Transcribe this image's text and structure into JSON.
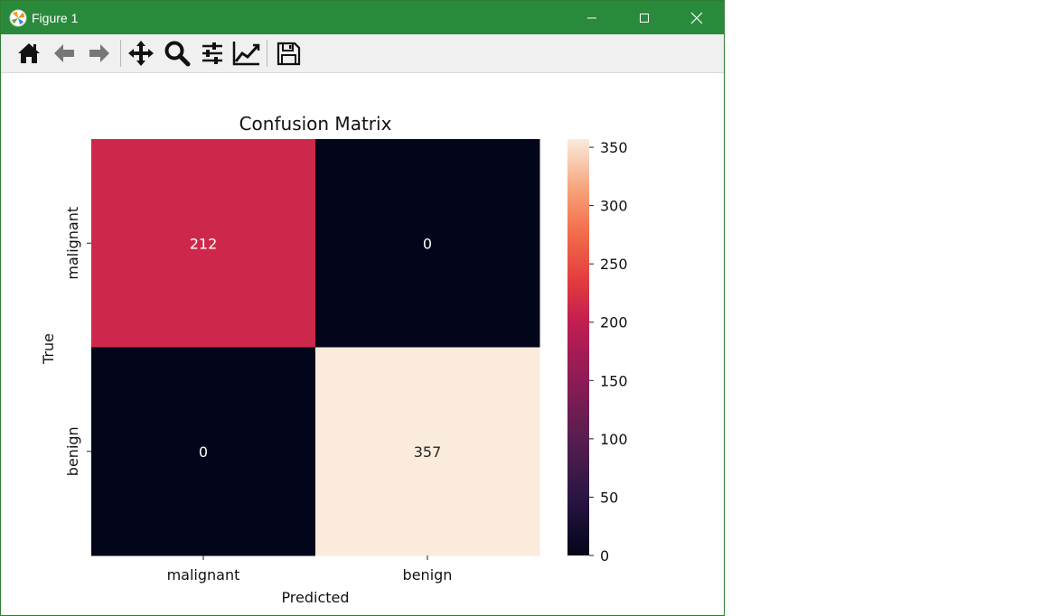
{
  "window": {
    "title": "Figure 1"
  },
  "toolbar": {
    "buttons": [
      {
        "name": "home-button",
        "icon": "home-icon"
      },
      {
        "name": "back-button",
        "icon": "arrow-left-icon"
      },
      {
        "name": "forward-button",
        "icon": "arrow-right-icon"
      },
      {
        "name": "pan-button",
        "icon": "move-icon"
      },
      {
        "name": "zoom-button",
        "icon": "magnifier-icon"
      },
      {
        "name": "configure-subplots-button",
        "icon": "sliders-icon"
      },
      {
        "name": "edit-axis-button",
        "icon": "line-chart-icon"
      },
      {
        "name": "save-button",
        "icon": "floppy-disk-icon"
      }
    ]
  },
  "colors": {
    "titlebar": "#2a8a3c",
    "heat_high": "#faebdd",
    "heat_212": "#e83e40",
    "heat_zero": "#03051a"
  },
  "chart_data": {
    "type": "heatmap",
    "title": "Confusion Matrix",
    "xlabel": "Predicted",
    "ylabel": "True",
    "x_categories": [
      "malignant",
      "benign"
    ],
    "y_categories": [
      "malignant",
      "benign"
    ],
    "values": [
      [
        212,
        0
      ],
      [
        0,
        357
      ]
    ],
    "colorbar": {
      "range": [
        0,
        357
      ],
      "ticks": [
        0,
        50,
        100,
        150,
        200,
        250,
        300,
        350
      ],
      "colormap": "rocket"
    },
    "grid": false
  }
}
